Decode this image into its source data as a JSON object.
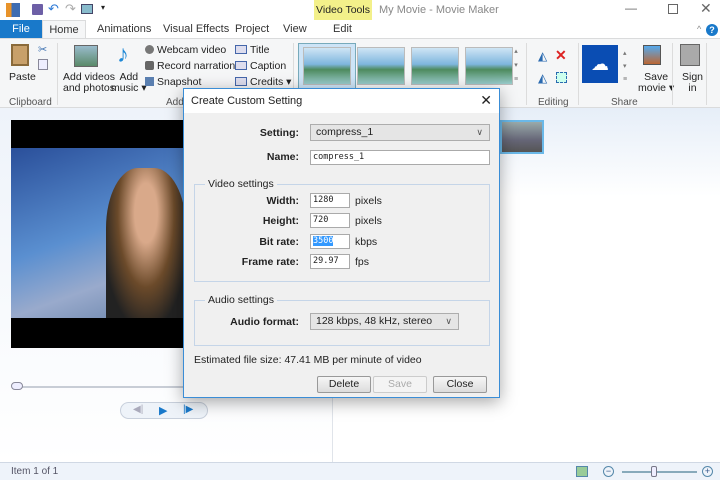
{
  "window": {
    "title": "My Movie - Movie Maker",
    "contextual_tab_group": "Video Tools"
  },
  "tabs": {
    "file": "File",
    "home": "Home",
    "animations": "Animations",
    "visual_effects": "Visual Effects",
    "project": "Project",
    "view": "View",
    "edit": "Edit"
  },
  "ribbon": {
    "clipboard": {
      "label": "Clipboard",
      "paste": "Paste"
    },
    "add": {
      "label": "Add",
      "add_videos_1": "Add videos",
      "add_videos_2": "and photos",
      "add_music_1": "Add",
      "add_music_2": "music",
      "webcam": "Webcam video",
      "narration": "Record narration",
      "snapshot": "Snapshot",
      "title": "Title",
      "caption": "Caption",
      "credits": "Credits"
    },
    "editing": {
      "label": "Editing"
    },
    "share": {
      "label": "Share",
      "save_movie_1": "Save",
      "save_movie_2": "movie"
    },
    "sign_in": {
      "line1": "Sign",
      "line2": "in"
    }
  },
  "dialog": {
    "title": "Create Custom Setting",
    "setting_label": "Setting:",
    "setting_value": "compress_1",
    "name_label": "Name:",
    "name_value": "compress_1",
    "video_legend": "Video settings",
    "width_label": "Width:",
    "width_value": "1280",
    "width_unit": "pixels",
    "height_label": "Height:",
    "height_value": "720",
    "height_unit": "pixels",
    "bitrate_label": "Bit rate:",
    "bitrate_value": "3500",
    "bitrate_unit": "kbps",
    "framerate_label": "Frame rate:",
    "framerate_value": "29.97",
    "framerate_unit": "fps",
    "audio_legend": "Audio settings",
    "audio_label": "Audio format:",
    "audio_value": "128 kbps, 48 kHz, stereo",
    "estimate": "Estimated file size: 47.41 MB per minute of video",
    "delete": "Delete",
    "save": "Save",
    "close": "Close"
  },
  "status": {
    "item": "Item 1 of 1"
  },
  "colors": {
    "accent": "#1979ca",
    "video_tools": "#f3f08a",
    "onedrive": "#0a4db3"
  }
}
